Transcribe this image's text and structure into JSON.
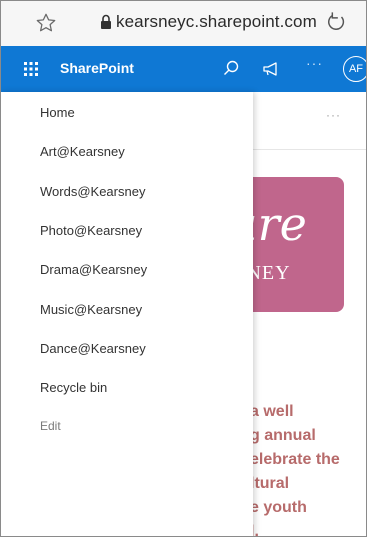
{
  "browser": {
    "url": "kearsneyc.sharepoint.com"
  },
  "suite_bar": {
    "app_name": "SharePoint",
    "more_label": "···",
    "avatar_initials": "AF",
    "bar_color": "#0f78d4"
  },
  "nav": {
    "items": [
      {
        "label": "Home"
      },
      {
        "label": "Art@Kearsney"
      },
      {
        "label": "Words@Kearsney"
      },
      {
        "label": "Photo@Kearsney"
      },
      {
        "label": "Drama@Kearsney"
      },
      {
        "label": "Music@Kearsney"
      },
      {
        "label": "Dance@Kearsney"
      },
      {
        "label": "Recycle bin"
      }
    ],
    "edit_label": "Edit"
  },
  "page": {
    "header_more": "···",
    "logo_script": "ure",
    "logo_sub": "RSNEY",
    "logo_color": "#c0668c",
    "body_lines": "a well\ng annual\nelebrate the\nltural\ne youth\nl."
  },
  "icons": {
    "favorite": "star-outline-icon",
    "secure": "lock-icon",
    "reload": "reload-icon",
    "app_launcher": "waffle-icon",
    "search": "search-icon",
    "megaphone": "megaphone-icon"
  }
}
